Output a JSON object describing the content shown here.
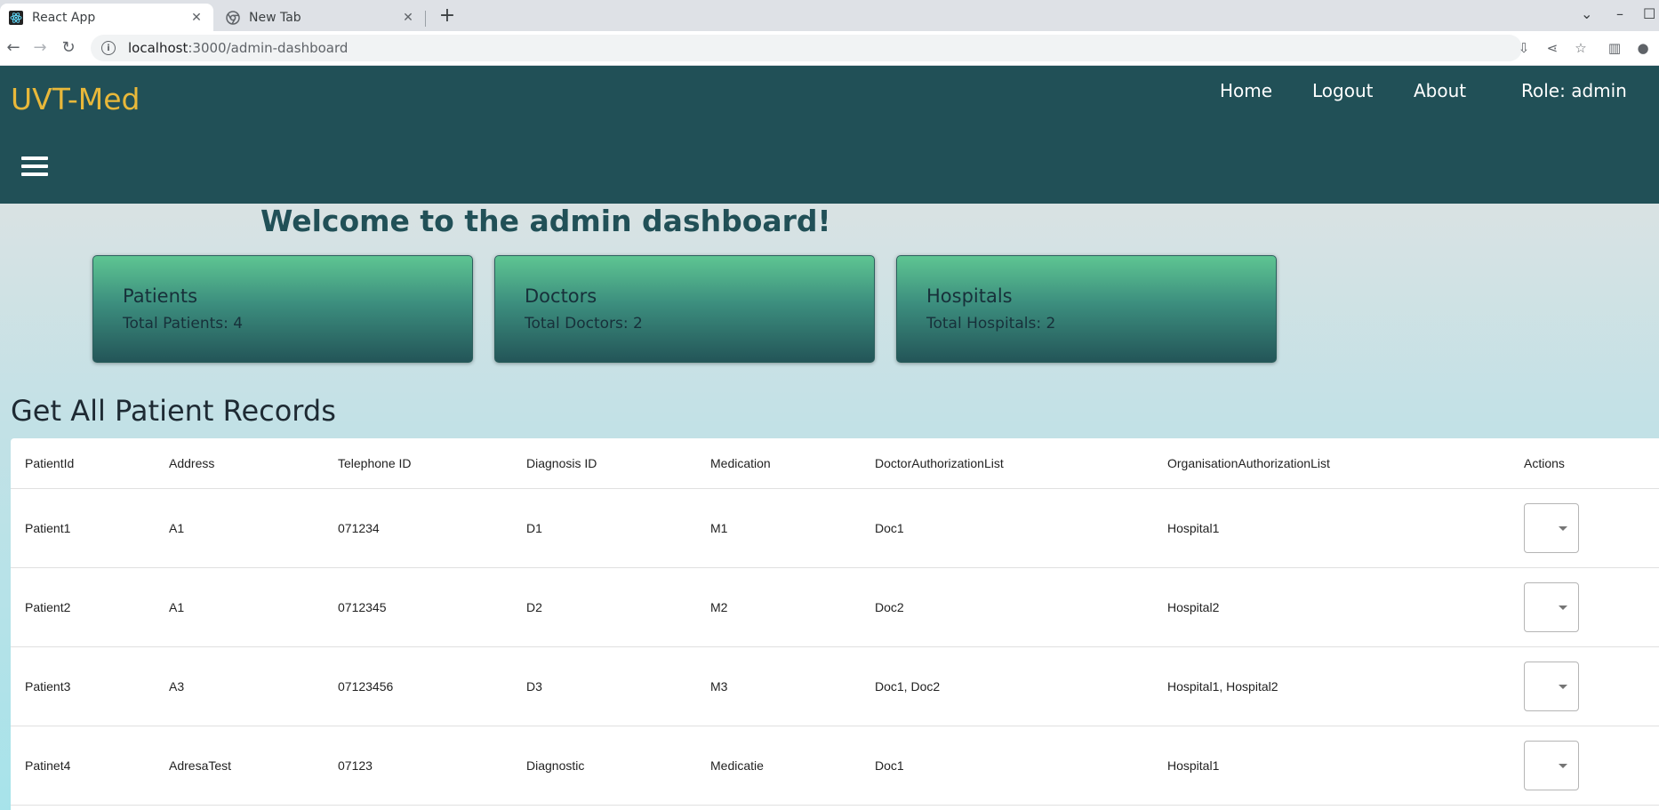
{
  "browser": {
    "tabs": [
      {
        "title": "React App",
        "active": true
      },
      {
        "title": "New Tab",
        "active": false
      }
    ],
    "url_host": "localhost",
    "url_path": ":3000/admin-dashboard"
  },
  "header": {
    "brand": "UVT-Med",
    "nav": [
      "Home",
      "Logout",
      "About"
    ],
    "role": "Role: admin",
    "brand_color": "#e8b83a",
    "bg_color": "#215057"
  },
  "main": {
    "welcome": "Welcome to the admin dashboard!",
    "cards": [
      {
        "title": "Patients",
        "subtitle": "Total Patients: 4"
      },
      {
        "title": "Doctors",
        "subtitle": "Total Doctors: 2"
      },
      {
        "title": "Hospitals",
        "subtitle": "Total Hospitals: 2"
      }
    ],
    "section_title": "Get All Patient Records"
  },
  "table": {
    "columns": [
      "PatientId",
      "Address",
      "Telephone ID",
      "Diagnosis ID",
      "Medication",
      "DoctorAuthorizationList",
      "OrganisationAuthorizationList",
      "Actions"
    ],
    "rows": [
      [
        "Patient1",
        "A1",
        "071234",
        "D1",
        "M1",
        "Doc1",
        "Hospital1"
      ],
      [
        "Patient2",
        "A1",
        "0712345",
        "D2",
        "M2",
        "Doc2",
        "Hospital2"
      ],
      [
        "Patient3",
        "A3",
        "07123456",
        "D3",
        "M3",
        "Doc1, Doc2",
        "Hospital1, Hospital2"
      ],
      [
        "Patinet4",
        "AdresaTest",
        "07123",
        "Diagnostic",
        "Medicatie",
        "Doc1",
        "Hospital1"
      ]
    ]
  }
}
